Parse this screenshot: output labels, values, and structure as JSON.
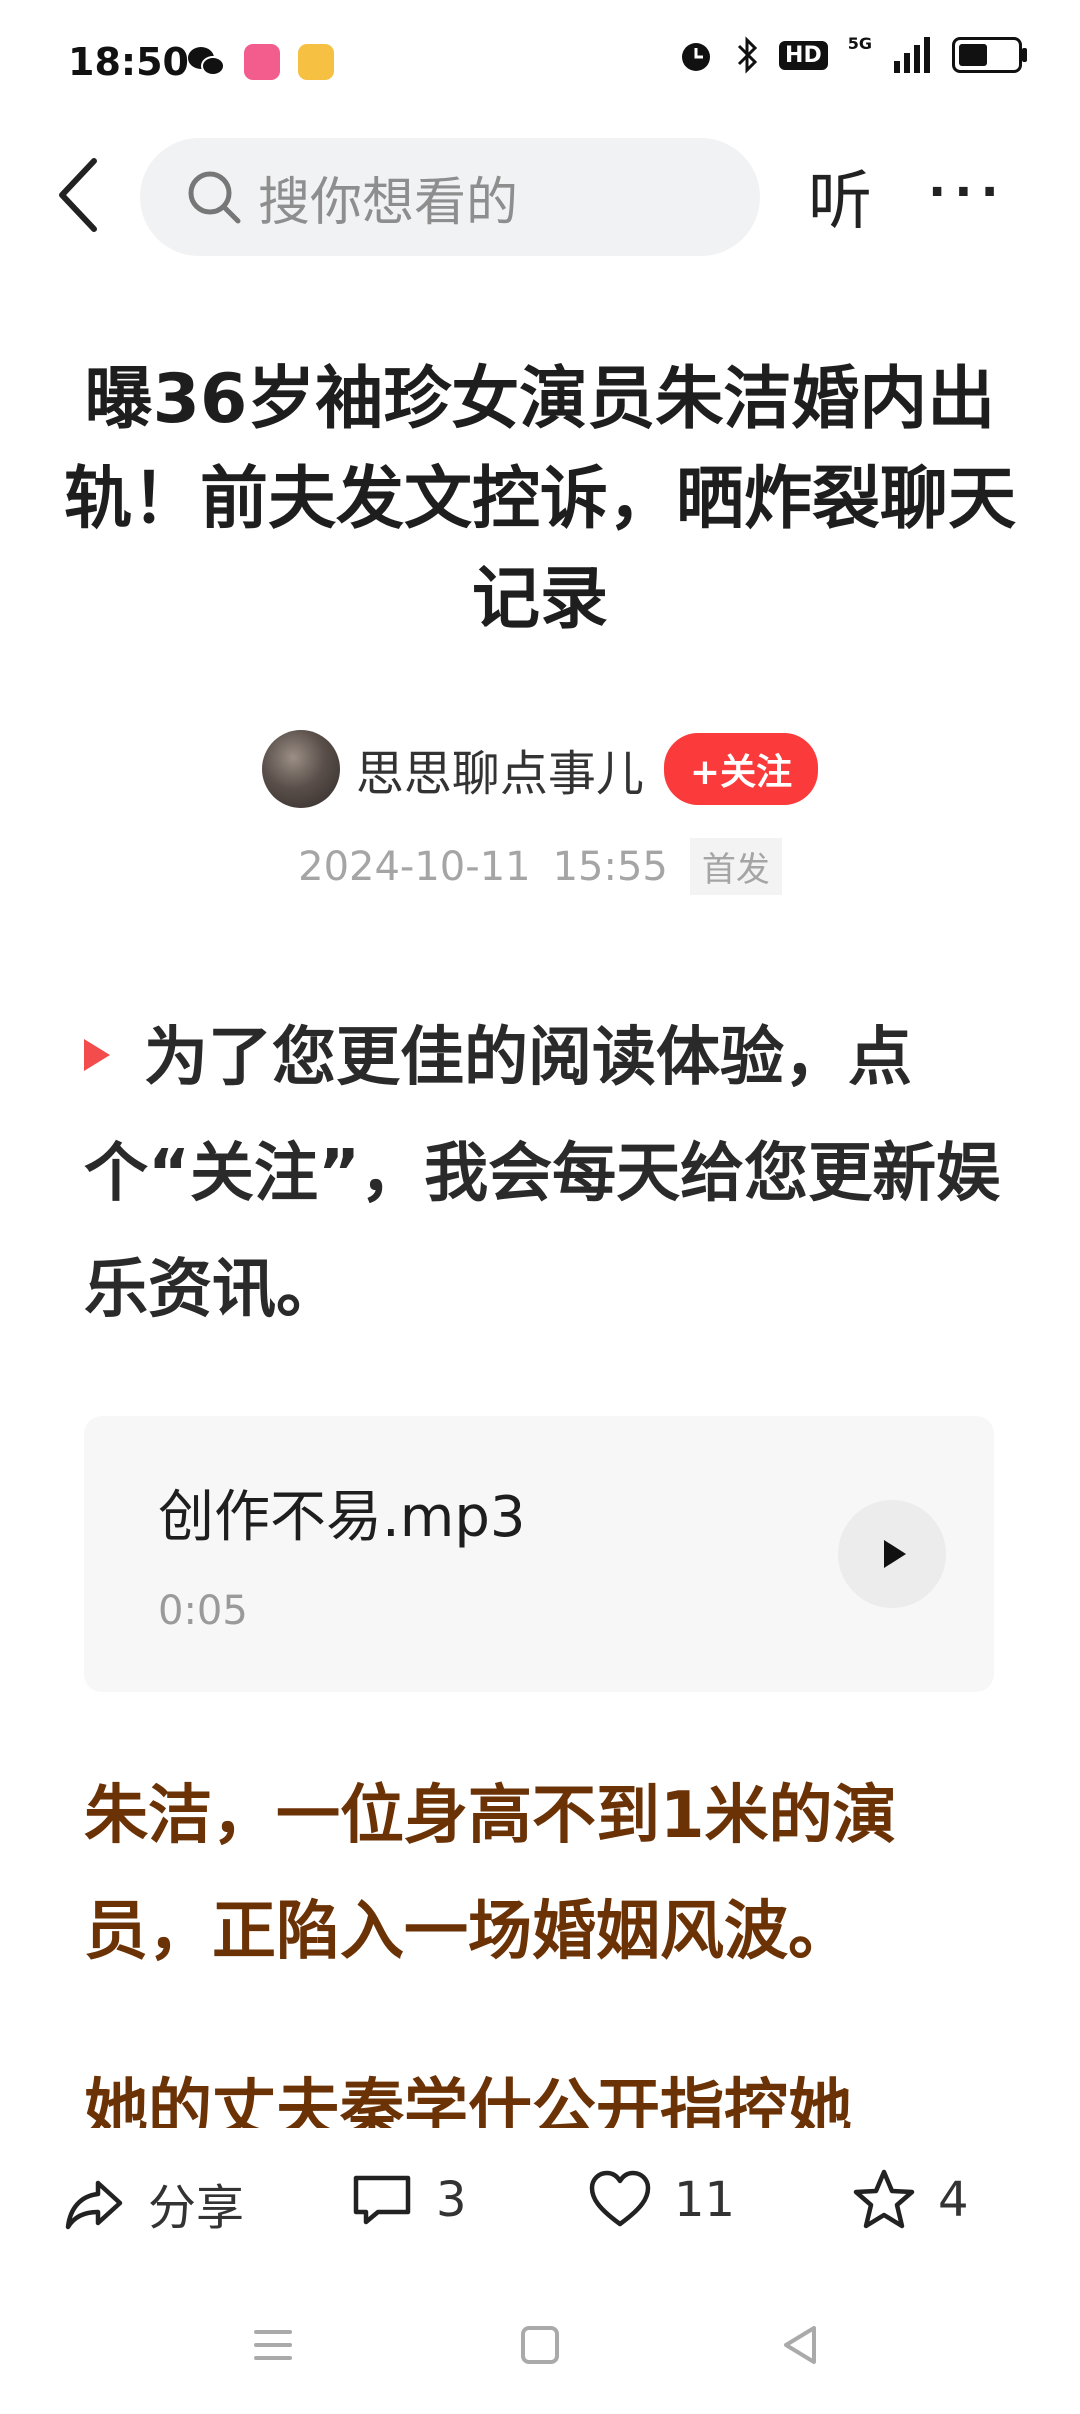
{
  "status_bar": {
    "time": "18:50",
    "network": "5G",
    "hd": "HD",
    "icons": [
      "wechat-icon",
      "bilibili-icon",
      "weibo-icon",
      "alarm-icon",
      "bluetooth-icon",
      "signal-icon",
      "battery-icon"
    ]
  },
  "top_nav": {
    "search_placeholder": "搜你想看的",
    "listen_label": "听",
    "more_label": "···"
  },
  "article": {
    "title": "曝36岁袖珍女演员朱洁婚内出轨！前夫发文控诉，晒炸裂聊天记录",
    "author_name": "思思聊点事儿",
    "follow_label": "+关注",
    "date": "2024-10-11",
    "time": "15:55",
    "badge": "首发",
    "intro": "为了您更佳的阅读体验，点个“关注”，我会每天给您更新娱乐资讯。",
    "audio": {
      "name": "创作不易.mp3",
      "duration": "0:05"
    },
    "paragraph1": "朱洁，一位身高不到1米的演员，正陷入一场婚姻风波。",
    "paragraph2": "她的丈夫秦学什公开指控她"
  },
  "actions": {
    "share_label": "分享",
    "comment_count": "3",
    "like_count": "11",
    "favorite_count": "4"
  },
  "colors": {
    "follow_red": "#fb3b3b",
    "article_brown": "#6b3206",
    "intro_marker": "#f24c4c"
  }
}
